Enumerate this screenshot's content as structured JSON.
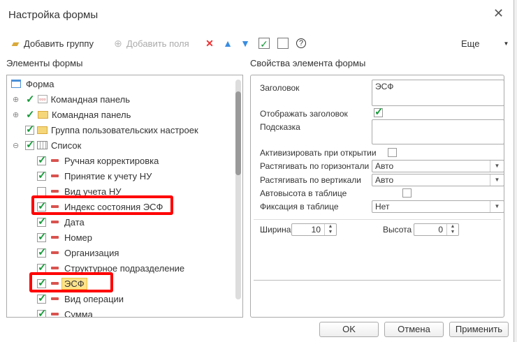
{
  "window": {
    "title": "Настройка формы"
  },
  "toolbar": {
    "add_group": "Добавить группу",
    "add_fields": "Добавить поля",
    "more": "Еще"
  },
  "left": {
    "header": "Элементы формы",
    "items": [
      {
        "label": "Форма"
      },
      {
        "label": "Командная панель"
      },
      {
        "label": "Командная панель"
      },
      {
        "label": "Группа пользовательских настроек"
      },
      {
        "label": "Список"
      },
      {
        "label": "Ручная корректировка",
        "checked": true
      },
      {
        "label": "Принятие к учету НУ",
        "checked": true
      },
      {
        "label": "Вид учета НУ",
        "checked": false
      },
      {
        "label": "Индекс состояния ЭСФ",
        "checked": true
      },
      {
        "label": "Дата",
        "checked": true
      },
      {
        "label": "Номер",
        "checked": true
      },
      {
        "label": "Организация",
        "checked": true
      },
      {
        "label": "Структурное подразделение",
        "checked": true
      },
      {
        "label": "ЭСФ",
        "checked": true,
        "selected": true
      },
      {
        "label": "Вид операции",
        "checked": true
      },
      {
        "label": "Сумма",
        "checked": true
      }
    ]
  },
  "right": {
    "header": "Свойства элемента формы",
    "title_label": "Заголовок",
    "title_value": "ЭСФ",
    "show_title_label": "Отображать заголовок",
    "show_title": true,
    "hint_label": "Подсказка",
    "hint_value": "",
    "activate_label": "Активизировать при открытии",
    "activate": false,
    "stretch_h_label": "Растягивать по горизонтали",
    "stretch_h": "Авто",
    "stretch_v_label": "Растягивать по вертикали",
    "stretch_v": "Авто",
    "autoheight_label": "Автовысота в таблице",
    "autoheight": false,
    "fix_label": "Фиксация в таблице",
    "fix": "Нет",
    "width_label": "Ширина",
    "width": "10",
    "height_label": "Высота",
    "height": "0"
  },
  "buttons": {
    "ok": "OK",
    "cancel": "Отмена",
    "apply": "Применить"
  },
  "colors": {
    "highlight": "#ff0000",
    "selected": "#fde38a",
    "check": "#1a9b3c"
  }
}
